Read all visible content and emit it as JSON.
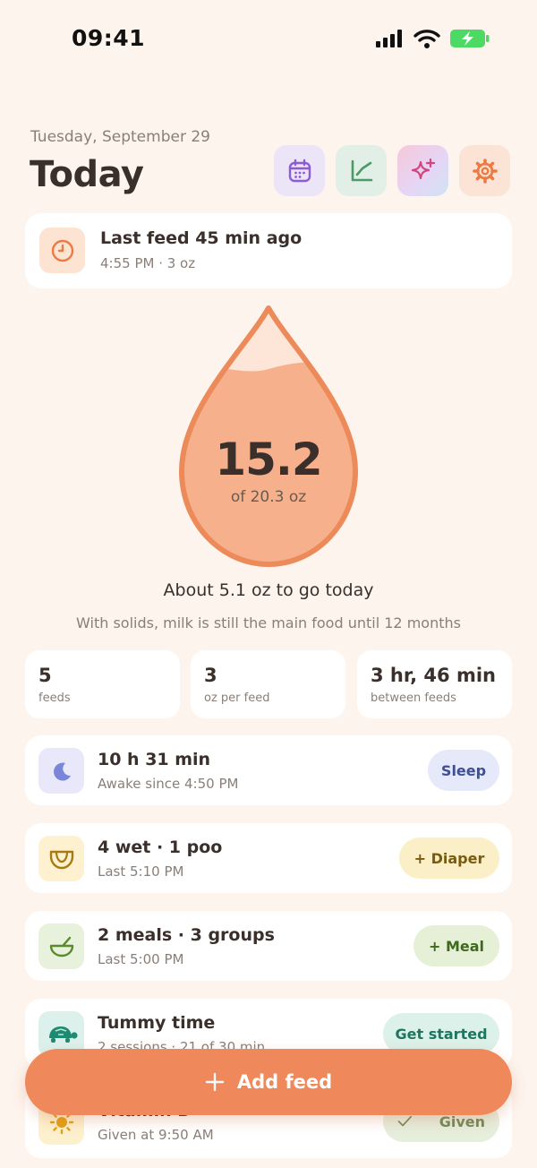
{
  "status": {
    "time": "09:41"
  },
  "header": {
    "date": "Tuesday, September 29",
    "title": "Today"
  },
  "last_feed": {
    "title": "Last feed 45 min ago",
    "detail": "4:55 PM · 3 oz"
  },
  "intake": {
    "value": "15.2",
    "of_label": "of 20.3 oz",
    "remaining": "About 5.1 oz to go today",
    "note": "With solids, milk is still the main food until 12 months",
    "fill_fraction": 0.75
  },
  "stats": [
    {
      "value": "5",
      "label": "feeds"
    },
    {
      "value": "3",
      "label": "oz per feed"
    },
    {
      "value": "3 hr, 46 min",
      "label": "between feeds"
    }
  ],
  "rows": {
    "sleep": {
      "title": "10 h 31 min",
      "sub": "Awake since 4:50 PM",
      "button": "Sleep"
    },
    "diaper": {
      "title": "4 wet · 1 poo",
      "sub": "Last 5:10 PM",
      "button": "+ Diaper"
    },
    "meal": {
      "title": "2 meals · 3 groups",
      "sub": "Last 5:00 PM",
      "button": "+ Meal"
    },
    "tummy": {
      "title": "Tummy time",
      "sub": "2 sessions · 21 of 30 min",
      "button": "Get started"
    },
    "vitamin": {
      "title": "Vitamin D",
      "sub": "Given at 9:50 AM",
      "button": "Given"
    }
  },
  "fab": {
    "label": "Add feed"
  },
  "colors": {
    "accent": "#ef885a",
    "background": "#fdf4ee",
    "card": "#ffffff"
  }
}
